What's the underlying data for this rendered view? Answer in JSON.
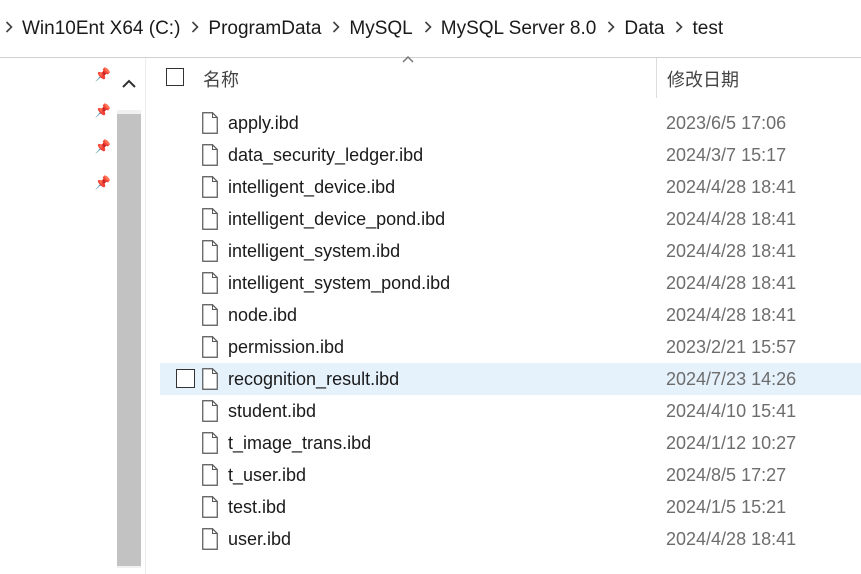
{
  "breadcrumb": {
    "items": [
      "Win10Ent X64 (C:)",
      "ProgramData",
      "MySQL",
      "MySQL Server 8.0",
      "Data",
      "test"
    ],
    "separator_icon": "chevron-right-icon"
  },
  "columns": {
    "name": "名称",
    "modified": "修改日期"
  },
  "nav": {
    "pins": [
      "pin-icon",
      "pin-icon",
      "pin-icon",
      "pin-icon"
    ]
  },
  "files": [
    {
      "name": "apply.ibd",
      "modified": "2023/6/5 17:06"
    },
    {
      "name": "data_security_ledger.ibd",
      "modified": "2024/3/7 15:17"
    },
    {
      "name": "intelligent_device.ibd",
      "modified": "2024/4/28 18:41"
    },
    {
      "name": "intelligent_device_pond.ibd",
      "modified": "2024/4/28 18:41"
    },
    {
      "name": "intelligent_system.ibd",
      "modified": "2024/4/28 18:41"
    },
    {
      "name": "intelligent_system_pond.ibd",
      "modified": "2024/4/28 18:41"
    },
    {
      "name": "node.ibd",
      "modified": "2024/4/28 18:41"
    },
    {
      "name": "permission.ibd",
      "modified": "2023/2/21 15:57"
    },
    {
      "name": "recognition_result.ibd",
      "modified": "2024/7/23 14:26"
    },
    {
      "name": "student.ibd",
      "modified": "2024/4/10 15:41"
    },
    {
      "name": "t_image_trans.ibd",
      "modified": "2024/1/12 10:27"
    },
    {
      "name": "t_user.ibd",
      "modified": "2024/8/5 17:27"
    },
    {
      "name": "test.ibd",
      "modified": "2024/1/5 15:21"
    },
    {
      "name": "user.ibd",
      "modified": "2024/4/28 18:41"
    }
  ],
  "hovered_index": 8,
  "colors": {
    "hover_bg": "#e5f1fb",
    "date_text": "#6d6d6d",
    "scroll_thumb": "#c2c2c2"
  }
}
